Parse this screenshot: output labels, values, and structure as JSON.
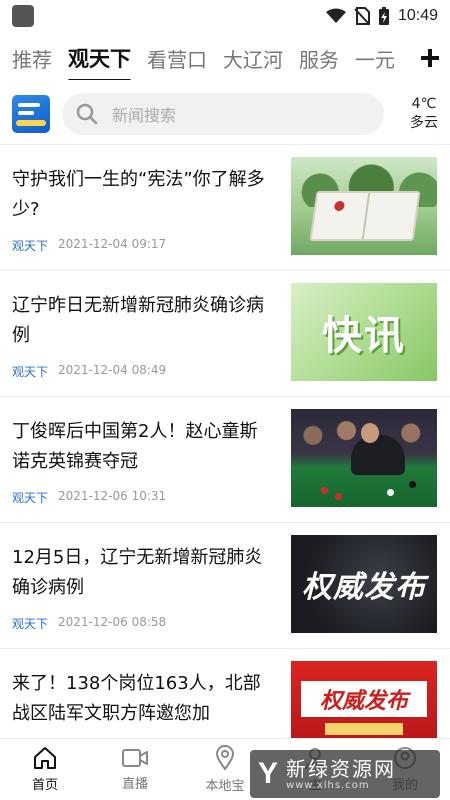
{
  "status_bar": {
    "time": "10:49"
  },
  "tabs": {
    "items": [
      "推荐",
      "观天下",
      "看营口",
      "大辽河",
      "服务",
      "一元"
    ],
    "active_index": 1
  },
  "header": {
    "logo_icon": "app-logo",
    "search_placeholder": "新闻搜索",
    "weather": {
      "temperature": "4℃",
      "condition": "多云"
    }
  },
  "news": [
    {
      "title": "守护我们一生的“宪法”你了解多少?",
      "source": "观天下",
      "date": "2021-12-04 09:17",
      "thumb": "book"
    },
    {
      "title": "辽宁昨日无新增新冠肺炎确诊病例",
      "source": "观天下",
      "date": "2021-12-04 08:49",
      "thumb": "kuaixun",
      "thumb_text": "快讯"
    },
    {
      "title": "丁俊晖后中国第2人！赵心童斯诺克英锦赛夺冠",
      "source": "观天下",
      "date": "2021-12-06 10:31",
      "thumb": "snooker"
    },
    {
      "title": "12月5日，辽宁无新增新冠肺炎确诊病例",
      "source": "观天下",
      "date": "2021-12-06 08:58",
      "thumb": "quanwei-dark",
      "thumb_text": "权威发布"
    },
    {
      "title": "来了！138个岗位163人，北部战区陆军文职方阵邀您加",
      "source": "",
      "date": "",
      "thumb": "quanwei-red",
      "thumb_text": "权威发布"
    }
  ],
  "bottom_nav": {
    "items": [
      {
        "label": "首页",
        "icon": "home-icon"
      },
      {
        "label": "直播",
        "icon": "video-icon"
      },
      {
        "label": "本地宝",
        "icon": "location-icon"
      },
      {
        "label": "主",
        "icon": "user-icon"
      },
      {
        "label": "我的",
        "icon": "profile-icon"
      }
    ],
    "active_index": 0
  },
  "watermark": {
    "title": "新绿资源网",
    "subtitle": "www.xlhs.com"
  },
  "colors": {
    "accent_blue": "#2a6fd0",
    "active_tab": "#111111"
  }
}
